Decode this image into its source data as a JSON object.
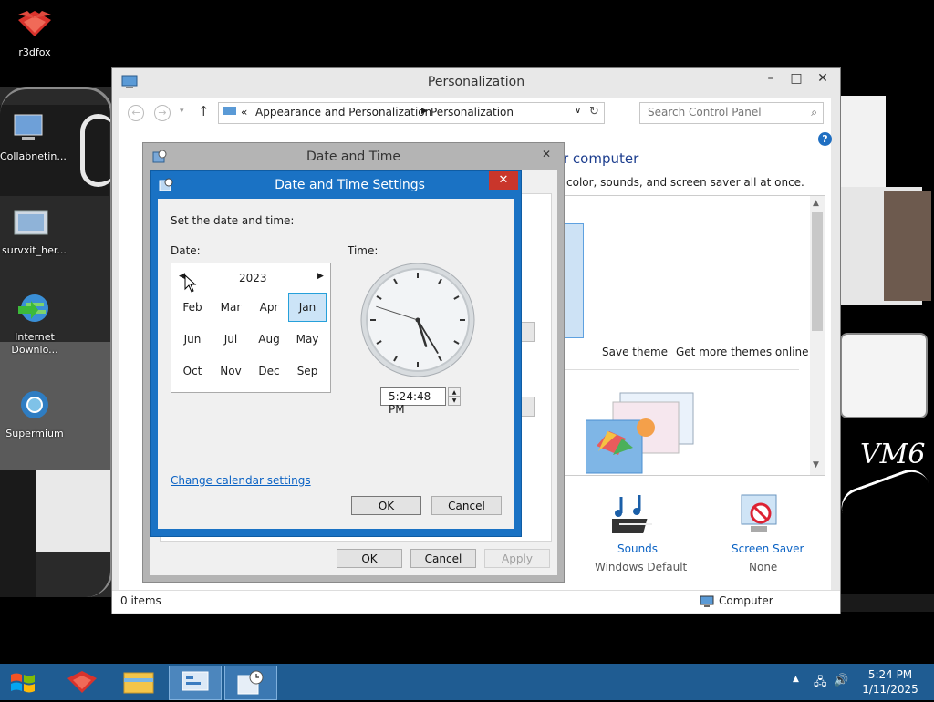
{
  "desktop": {
    "icons": [
      {
        "label": "r3dfox"
      },
      {
        "label": "Collabnetin..."
      },
      {
        "label": "survxit_her..."
      },
      {
        "label": "Internet Downlo..."
      },
      {
        "label": "Supermium"
      }
    ],
    "vm_label": "VM6"
  },
  "personalization": {
    "title": "Personalization",
    "breadcrumb": {
      "sep": "«",
      "parent": "Appearance and Personalization",
      "current": "Personalization"
    },
    "search_placeholder": "Search Control Panel",
    "heading_fragment": "r computer",
    "desc_fragment": "color, sounds, and screen saver all at once.",
    "save_theme": "Save theme",
    "get_more_themes": "Get more themes online",
    "sounds_label": "Sounds",
    "sounds_value": "Windows Default",
    "screensaver_label": "Screen Saver",
    "screensaver_value": "None",
    "status_items": "0 items",
    "status_computer": "Computer",
    "ok": "OK",
    "cancel": "Cancel",
    "apply": "Apply"
  },
  "datetime_dialog": {
    "title": "Date and Time"
  },
  "dts_dialog": {
    "title": "Date and Time Settings",
    "instruction": "Set the date and time:",
    "date_label": "Date:",
    "time_label": "Time:",
    "year": "2023",
    "months": [
      [
        "Feb",
        "Mar",
        "Apr",
        "Jan"
      ],
      [
        "Jun",
        "Jul",
        "Aug",
        "May"
      ],
      [
        "Oct",
        "Nov",
        "Dec",
        "Sep"
      ]
    ],
    "selected_month": "Jan",
    "time_value": "5:24:48 PM",
    "change_calendar": "Change calendar settings",
    "ok": "OK",
    "cancel": "Cancel",
    "clock": {
      "hour": 5,
      "minute": 24,
      "second": 48
    }
  },
  "taskbar": {
    "time": "5:24 PM",
    "date": "1/11/2025"
  }
}
